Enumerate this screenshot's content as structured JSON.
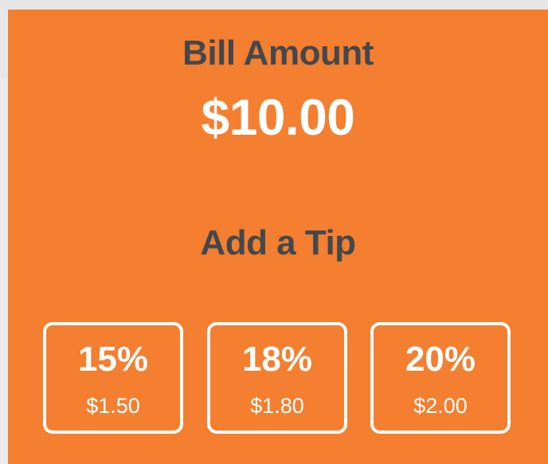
{
  "bill": {
    "title": "Bill Amount",
    "amount": "$10.00"
  },
  "tip": {
    "title": "Add a Tip",
    "options": [
      {
        "percent": "15%",
        "amount": "$1.50"
      },
      {
        "percent": "18%",
        "amount": "$1.80"
      },
      {
        "percent": "20%",
        "amount": "$2.00"
      }
    ]
  },
  "colors": {
    "accent": "#f47f30",
    "heading": "#43484d",
    "text_light": "#ffffff",
    "background": "#ececec"
  }
}
